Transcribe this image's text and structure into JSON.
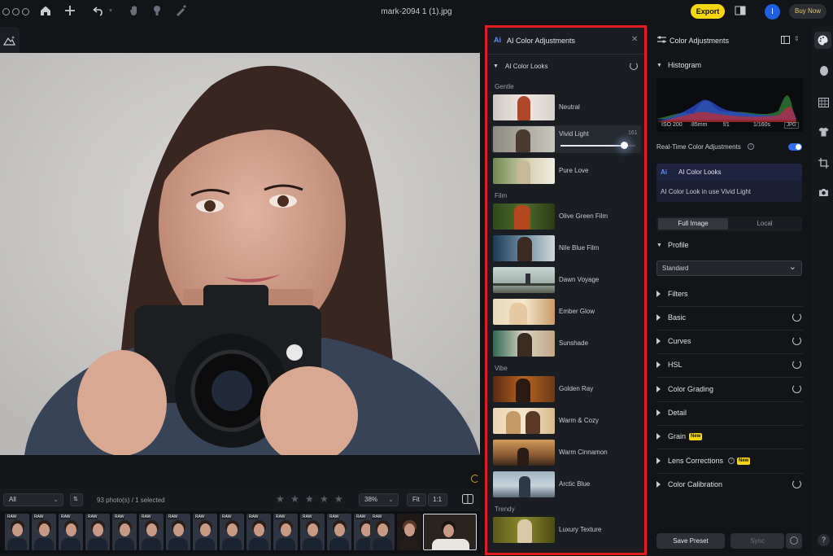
{
  "app": {
    "file_name": "mark-2094 1 (1).jpg",
    "export_label": "Export",
    "avatar_letter": "I",
    "buy_label": "Buy Now"
  },
  "colors": {
    "accent_yellow": "#f5d60f",
    "accent_blue": "#1f5fe0",
    "highlight_red": "#e01e1e",
    "panel": "#1a1d22",
    "background": "#121418"
  },
  "toolbar_icons": [
    "home-icon",
    "plus-icon",
    "undo-icon",
    "hand-icon",
    "stamp-icon",
    "brush-icon"
  ],
  "filter_bar": {
    "filter_value": "All",
    "count_text": "93 photo(s) / 1 selected",
    "star_rating": 0,
    "zoom_value": "38%",
    "fit_label": "Fit",
    "one_to_one_label": "1:1"
  },
  "filmstrip": {
    "raw_tag": "RAW"
  },
  "ai_panel": {
    "title": "AI Color Adjustments",
    "logo": "Ai",
    "section_title": "AI Color Looks",
    "categories": {
      "gentle": "Gentle",
      "film": "Film",
      "vibe": "Vibe",
      "trendy": "Trendy"
    },
    "looks": {
      "neutral": "Neutral",
      "vivid_light": "Vivid Light",
      "pure_love": "Pure Love",
      "olive_green_film": "Olive Green Film",
      "nile_blue_film": "Nile Blue Film",
      "dawn_voyage": "Dawn Voyage",
      "ember_glow": "Ember Glow",
      "sunshade": "Sunshade",
      "golden_ray": "Golden Ray",
      "warm_cozy": "Warm & Cozy",
      "warm_cinnamon": "Warm Cinnamon",
      "arctic_blue": "Arctic Blue",
      "luxury_texture": "Luxury Texture"
    },
    "vivid_light_intensity": "161",
    "vivid_light_slider_fraction": 0.85
  },
  "adjustments": {
    "title": "Color Adjustments",
    "histogram_label": "Histogram",
    "exif": {
      "iso": "ISO 200",
      "focal": "85mm",
      "aperture": "f/1",
      "shutter": "1/160s",
      "format": "JPG"
    },
    "realtime_label": "Real-Time Color Adjustments",
    "realtime_on": true,
    "ai_looks_card": {
      "logo": "Ai",
      "title": "AI Color Looks",
      "status": "AI Color Look in use Vivid Light"
    },
    "tabs": {
      "full": "Full Image",
      "local": "Local"
    },
    "profile_label": "Profile",
    "profile_value": "Standard",
    "sections": {
      "filters": "Filters",
      "basic": "Basic",
      "curves": "Curves",
      "hsl": "HSL",
      "color_grading": "Color Grading",
      "detail": "Detail",
      "grain": "Grain",
      "lens": "Lens Corrections",
      "calibration": "Color Calibration"
    },
    "new_badge": "New",
    "save_preset": "Save Preset",
    "sync": "Sync"
  },
  "help_label": "?"
}
